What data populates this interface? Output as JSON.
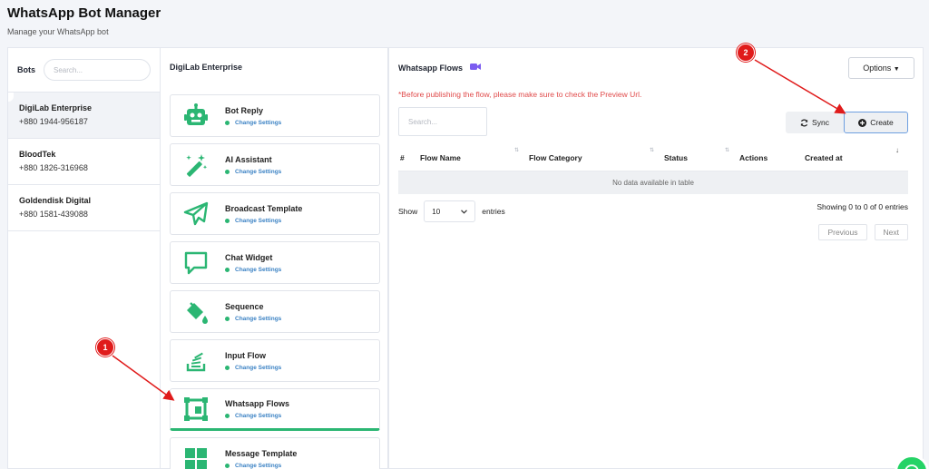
{
  "header": {
    "title": "WhatsApp Bot Manager",
    "subtitle": "Manage your WhatsApp bot"
  },
  "bots": {
    "title": "Bots",
    "search_placeholder": "Search...",
    "items": [
      {
        "name": "DigiLab Enterprise",
        "phone": "+880 1944-956187"
      },
      {
        "name": "BloodTek",
        "phone": "+880 1826-316968"
      },
      {
        "name": "Goldendisk Digital",
        "phone": "+880 1581-439088"
      }
    ]
  },
  "features": {
    "title": "DigiLab Enterprise",
    "change_label": "Change Settings",
    "items": [
      {
        "label": "Bot Reply",
        "icon": "robot-icon"
      },
      {
        "label": "AI Assistant",
        "icon": "magic-wand-icon"
      },
      {
        "label": "Broadcast Template",
        "icon": "paper-plane-icon"
      },
      {
        "label": "Chat Widget",
        "icon": "chat-bubble-icon"
      },
      {
        "label": "Sequence",
        "icon": "paint-bucket-icon"
      },
      {
        "label": "Input Flow",
        "icon": "stack-icon"
      },
      {
        "label": "Whatsapp Flows",
        "icon": "frame-icon"
      },
      {
        "label": "Message Template",
        "icon": "grid-icon"
      }
    ]
  },
  "flows": {
    "title": "Whatsapp Flows",
    "options_label": "Options",
    "warning": "*Before publishing the flow, please make sure to check the Preview Url.",
    "search_placeholder": "Search...",
    "sync_label": "Sync",
    "create_label": "Create",
    "columns": [
      "#",
      "Flow Name",
      "Flow Category",
      "Status",
      "Actions",
      "Created at"
    ],
    "empty_message": "No data available in table",
    "show_label": "Show",
    "entries_value": "10",
    "entries_label": "entries",
    "showing_text": "Showing 0 to 0 of 0 entries",
    "prev_label": "Previous",
    "next_label": "Next"
  },
  "markers": [
    "1",
    "2"
  ],
  "colors": {
    "accent_green": "#2bb673",
    "link_blue": "#3b82c4",
    "warning_red": "#e04a4a",
    "marker_red": "#e01b1b"
  }
}
